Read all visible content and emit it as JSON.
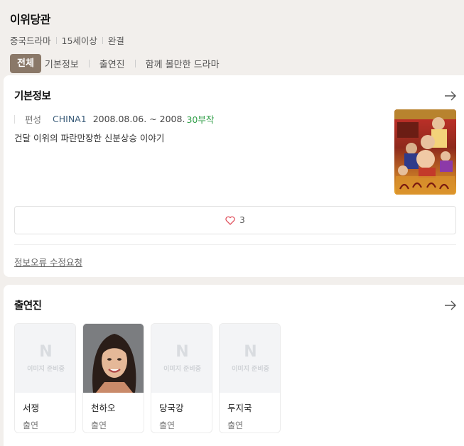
{
  "header": {
    "title": "이위당관",
    "meta": [
      "중국드라마",
      "15세이상",
      "완결"
    ]
  },
  "tabs": [
    {
      "label": "전체",
      "active": true
    },
    {
      "label": "기본정보",
      "active": false
    },
    {
      "label": "출연진",
      "active": false
    },
    {
      "label": "함께 볼만한 드라마",
      "active": false
    }
  ],
  "basic_info": {
    "title": "기본정보",
    "broadcast_label": "편성",
    "channel": "CHINA1",
    "dates": "2008.08.06. ~ 2008.",
    "episodes": "30부작",
    "summary": "건달 이위의 파란만장한 신분상승 이야기",
    "like_count": "3",
    "report_link": "정보오류 수정요청"
  },
  "cast": {
    "title": "출연진",
    "placeholder_text": "이미지 준비중",
    "placeholder_letter": "N",
    "members": [
      {
        "name": "서쟁",
        "role": "출연",
        "has_photo": false
      },
      {
        "name": "천하오",
        "role": "출연",
        "has_photo": true
      },
      {
        "name": "당국강",
        "role": "출연",
        "has_photo": false
      },
      {
        "name": "두지국",
        "role": "출연",
        "has_photo": false
      }
    ]
  },
  "colors": {
    "active_tab": "#8a7868",
    "episodes": "#2f9e47",
    "channel": "#3b5d7a",
    "heart": "#e0515d"
  }
}
